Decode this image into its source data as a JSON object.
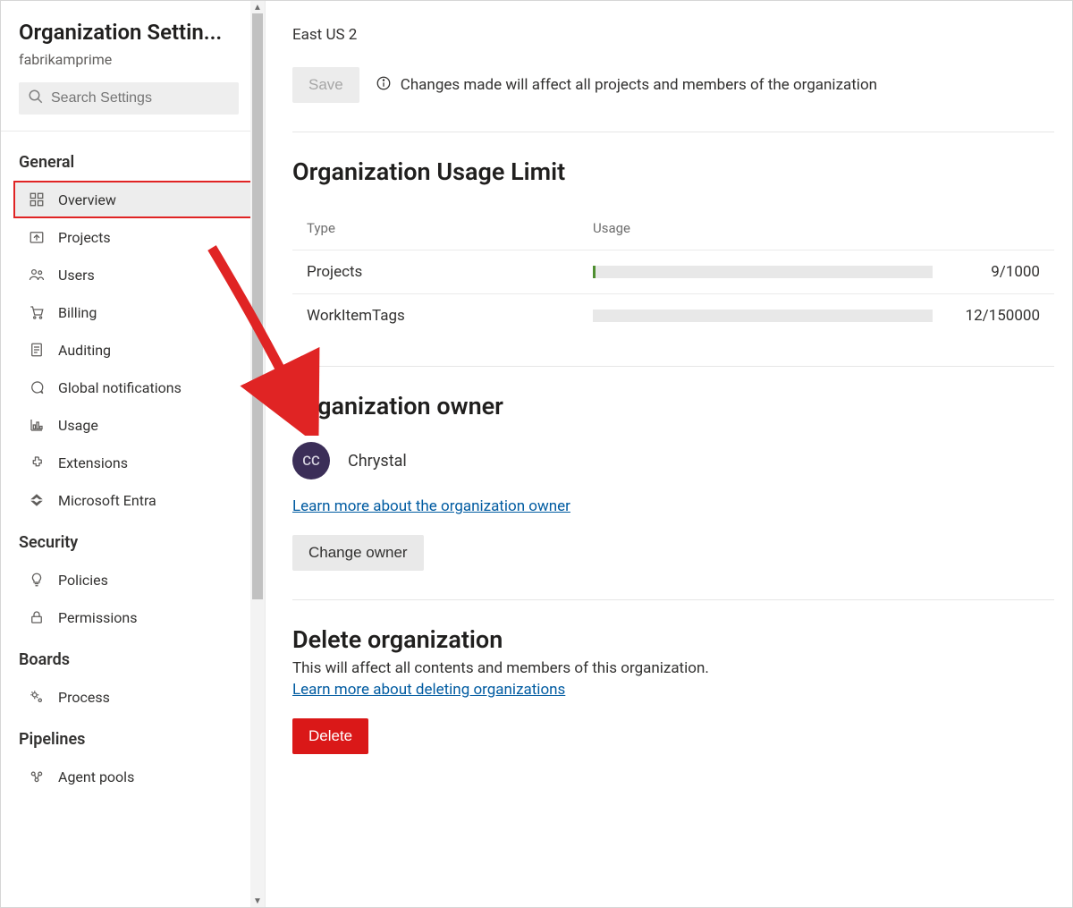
{
  "sidebar": {
    "title": "Organization Settin...",
    "subtitle": "fabrikamprime",
    "search_placeholder": "Search Settings",
    "sections": {
      "general": {
        "label": "General",
        "items": [
          {
            "label": "Overview",
            "icon": "grid-icon",
            "selected": true
          },
          {
            "label": "Projects",
            "icon": "upload-box-icon"
          },
          {
            "label": "Users",
            "icon": "people-icon"
          },
          {
            "label": "Billing",
            "icon": "cart-icon"
          },
          {
            "label": "Auditing",
            "icon": "clipboard-icon"
          },
          {
            "label": "Global notifications",
            "icon": "chat-icon"
          },
          {
            "label": "Usage",
            "icon": "chart-icon"
          },
          {
            "label": "Extensions",
            "icon": "puzzle-icon"
          },
          {
            "label": "Microsoft Entra",
            "icon": "entra-icon"
          }
        ]
      },
      "security": {
        "label": "Security",
        "items": [
          {
            "label": "Policies",
            "icon": "bulb-icon"
          },
          {
            "label": "Permissions",
            "icon": "lock-icon"
          }
        ]
      },
      "boards": {
        "label": "Boards",
        "items": [
          {
            "label": "Process",
            "icon": "gears-icon"
          }
        ]
      },
      "pipelines": {
        "label": "Pipelines",
        "items": [
          {
            "label": "Agent pools",
            "icon": "pools-icon"
          }
        ]
      }
    }
  },
  "main": {
    "region": "East US 2",
    "save_button": "Save",
    "save_note": "Changes made will affect all projects and members of the organization",
    "usage_limit": {
      "heading": "Organization Usage Limit",
      "col_type": "Type",
      "col_usage": "Usage",
      "rows": [
        {
          "type": "Projects",
          "used": 9,
          "max": 1000,
          "display": "9/1000"
        },
        {
          "type": "WorkItemTags",
          "used": 12,
          "max": 150000,
          "display": "12/150000"
        }
      ]
    },
    "owner": {
      "heading": "Organization owner",
      "avatar_initials": "CC",
      "name": "Chrystal",
      "learn_more": "Learn more about the organization owner",
      "change_button": "Change owner"
    },
    "delete_org": {
      "heading": "Delete organization",
      "description": "This will affect all contents and members of this organization.",
      "learn_more": "Learn more about deleting organizations",
      "button": "Delete"
    }
  }
}
